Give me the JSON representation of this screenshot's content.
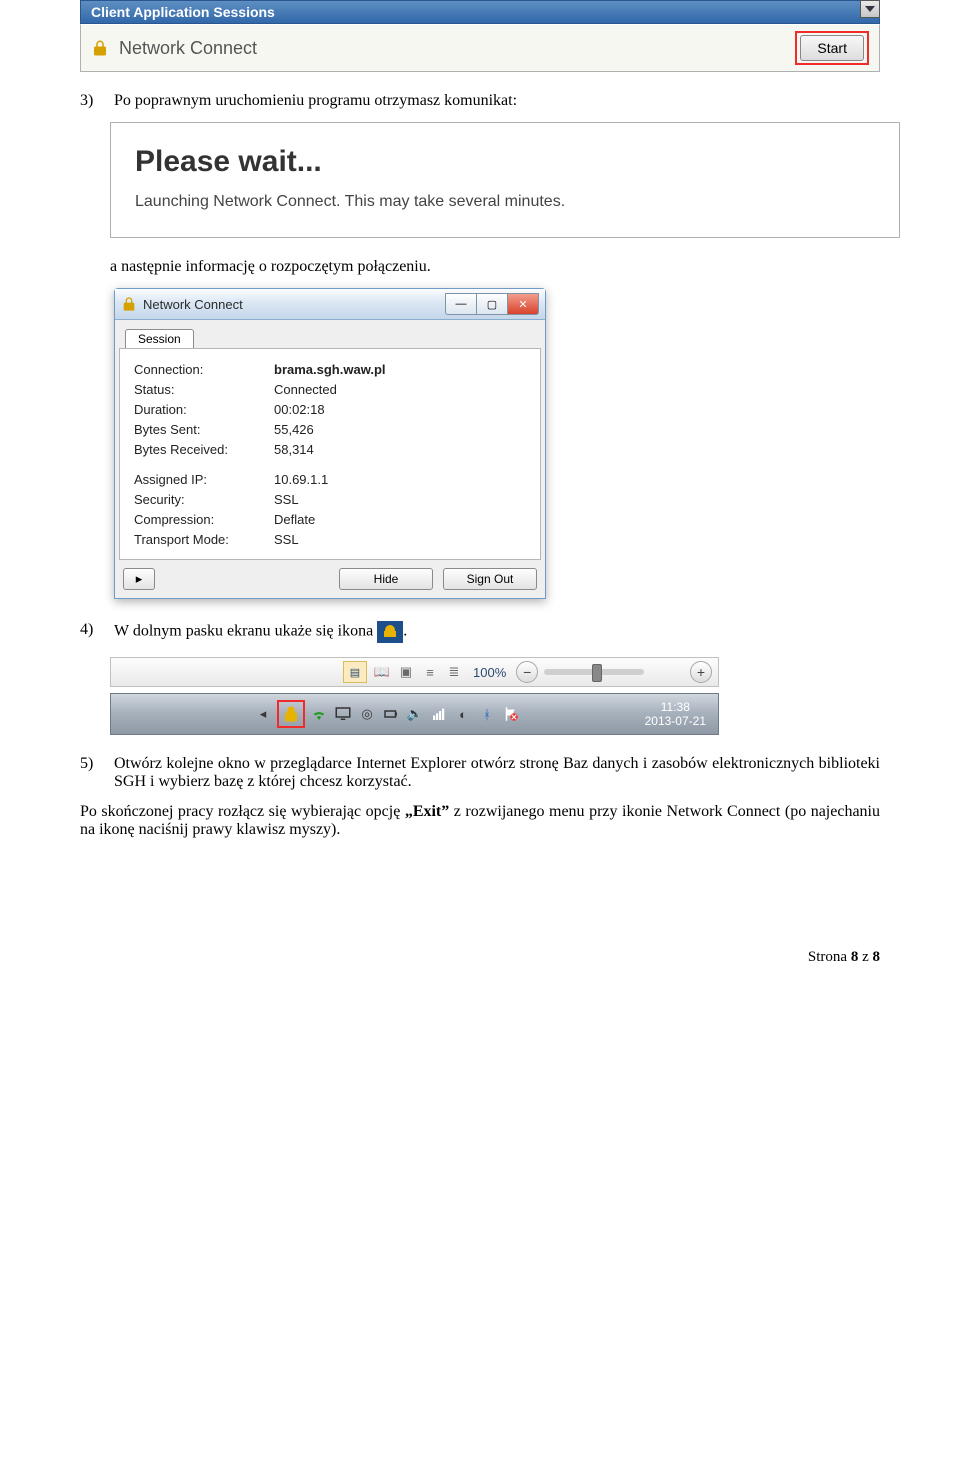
{
  "panel": {
    "header": "Client Application Sessions",
    "row_title": "Network Connect",
    "start_label": "Start"
  },
  "step3": {
    "num": "3)",
    "text_a": "Po poprawnym uruchomieniu programu otrzymasz komunikat:",
    "text_b": "a następnie informację o rozpoczętym połączeniu."
  },
  "wait_box": {
    "title": "Please wait...",
    "sub": "Launching Network Connect. This may take several minutes."
  },
  "nc_window": {
    "title": "Network Connect",
    "tab": "Session",
    "rows": [
      {
        "k": "Connection:",
        "v": "brama.sgh.waw.pl",
        "bold": true
      },
      {
        "k": "Status:",
        "v": "Connected"
      },
      {
        "k": "Duration:",
        "v": "00:02:18"
      },
      {
        "k": "Bytes Sent:",
        "v": "55,426"
      },
      {
        "k": "Bytes Received:",
        "v": "58,314"
      }
    ],
    "rows2": [
      {
        "k": "Assigned IP:",
        "v": "10.69.1.1"
      },
      {
        "k": "Security:",
        "v": "SSL"
      },
      {
        "k": "Compression:",
        "v": "Deflate"
      },
      {
        "k": "Transport Mode:",
        "v": "SSL"
      }
    ],
    "hide": "Hide",
    "signout": "Sign Out"
  },
  "step4": {
    "num": "4)",
    "text": "W dolnym pasku ekranu ukaże się ikona",
    "text_end": "."
  },
  "zoom": {
    "pct": "100%"
  },
  "clock": {
    "time": "11:38",
    "date": "2013-07-21"
  },
  "step5": {
    "num": "5)",
    "text1": "Otwórz kolejne okno w przeglądarce Internet Explorer otwórz stronę  Baz  danych i zasobów elektronicznych biblioteki SGH i wybierz bazę z której chcesz korzystać.",
    "text2_a": "Po skończonej pracy rozłącz się wybierając opcję ",
    "text2_b": "„Exit”",
    "text2_c": " z rozwijanego menu przy ikonie Network Connect (po najechaniu na ikonę naciśnij prawy klawisz myszy)."
  },
  "footer": {
    "a": "Strona ",
    "curr": "8",
    "b": " z ",
    "total": "8"
  }
}
